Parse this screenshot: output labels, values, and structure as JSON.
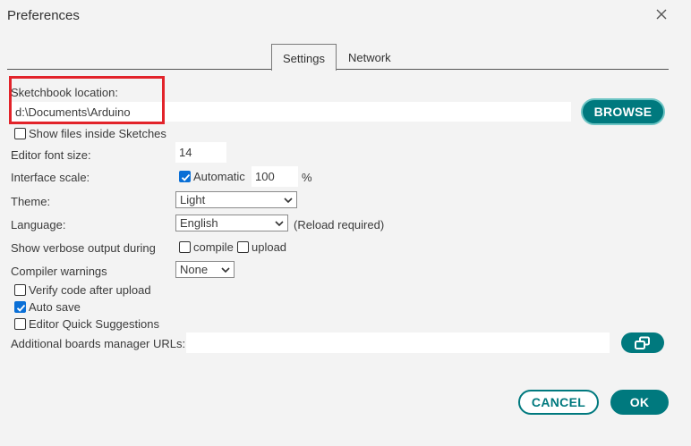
{
  "window": {
    "title": "Preferences"
  },
  "tabs": [
    {
      "label": "Settings",
      "active": true
    },
    {
      "label": "Network",
      "active": false
    }
  ],
  "sketchbook": {
    "label": "Sketchbook location:",
    "value": "d:\\Documents\\Arduino",
    "browse_label": "BROWSE"
  },
  "show_files": {
    "label": "Show files inside Sketches",
    "checked": false
  },
  "font_size": {
    "label": "Editor font size:",
    "value": "14"
  },
  "interface_scale": {
    "label": "Interface scale:",
    "automatic_label": "Automatic",
    "automatic_checked": true,
    "value": "100",
    "unit": "%"
  },
  "theme": {
    "label": "Theme:",
    "value": "Light"
  },
  "language": {
    "label": "Language:",
    "value": "English",
    "note": "(Reload required)"
  },
  "verbose": {
    "label": "Show verbose output during",
    "compile_label": "compile",
    "compile_checked": false,
    "upload_label": "upload",
    "upload_checked": false
  },
  "compiler_warnings": {
    "label": "Compiler warnings",
    "value": "None"
  },
  "verify": {
    "label": "Verify code after upload",
    "checked": false
  },
  "auto_save": {
    "label": "Auto save",
    "checked": true
  },
  "quick_suggestions": {
    "label": "Editor Quick Suggestions",
    "checked": false
  },
  "boards_urls": {
    "label": "Additional boards manager URLs:",
    "value": ""
  },
  "footer": {
    "cancel_label": "CANCEL",
    "ok_label": "OK"
  },
  "colors": {
    "accent": "#00797e",
    "highlight_box": "#e2232a",
    "checkbox_checked": "#0a6fd6",
    "background": "#f3f3f3"
  }
}
